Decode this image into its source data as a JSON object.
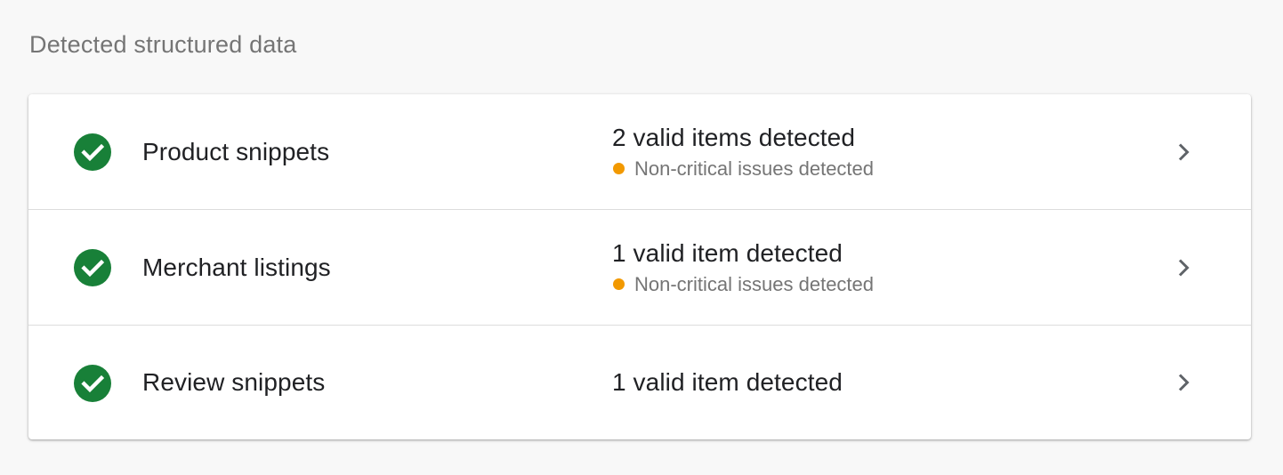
{
  "section": {
    "title": "Detected structured data"
  },
  "colors": {
    "success": "#188038",
    "warning": "#f29900",
    "chevron": "#5f6368"
  },
  "items": [
    {
      "title": "Product snippets",
      "status": "2 valid items detected",
      "issue": "Non-critical issues detected",
      "icon": "check-circle-icon"
    },
    {
      "title": "Merchant listings",
      "status": "1 valid item detected",
      "issue": "Non-critical issues detected",
      "icon": "check-circle-icon"
    },
    {
      "title": "Review snippets",
      "status": "1 valid item detected",
      "issue": null,
      "icon": "check-circle-icon"
    }
  ]
}
